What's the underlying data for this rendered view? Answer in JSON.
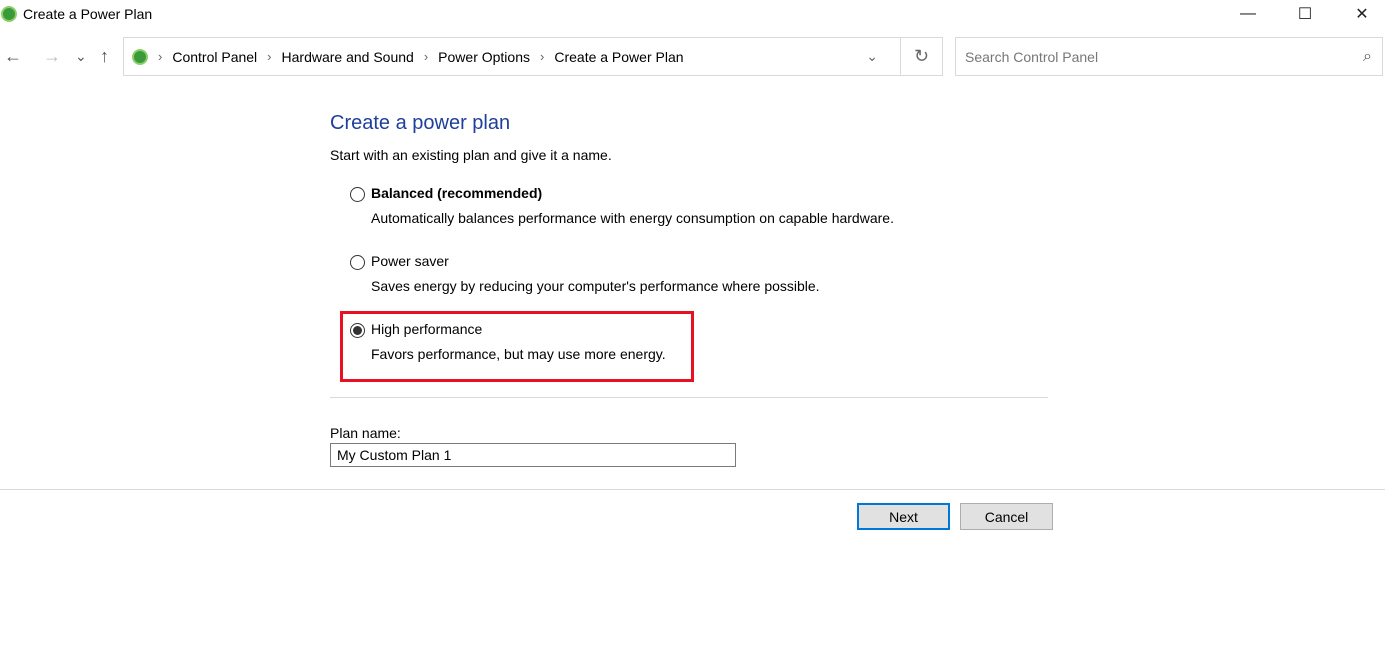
{
  "window": {
    "title": "Create a Power Plan",
    "minimize": "—",
    "maximize": "☐",
    "close": "✕"
  },
  "nav": {
    "back": "←",
    "forward": "→",
    "recent": "⌄",
    "up": "↑",
    "refresh": "↻",
    "dropdown": "⌄"
  },
  "breadcrumb": [
    "Control Panel",
    "Hardware and Sound",
    "Power Options",
    "Create a Power Plan"
  ],
  "search": {
    "placeholder": "Search Control Panel",
    "icon": "⌕"
  },
  "main": {
    "heading": "Create a power plan",
    "intro": "Start with an existing plan and give it a name.",
    "options": [
      {
        "label": "Balanced (recommended)",
        "desc": "Automatically balances performance with energy consumption on capable hardware.",
        "selected": false
      },
      {
        "label": "Power saver",
        "desc": "Saves energy by reducing your computer's performance where possible.",
        "selected": false
      },
      {
        "label": "High performance",
        "desc": "Favors performance, but may use more energy.",
        "selected": true
      }
    ],
    "plan_name_label": "Plan name:",
    "plan_name_value": "My Custom Plan 1",
    "next": "Next",
    "cancel": "Cancel"
  },
  "colors": {
    "heading": "#1e3f9b",
    "highlight": "#e81123",
    "focus": "#0078d7"
  }
}
